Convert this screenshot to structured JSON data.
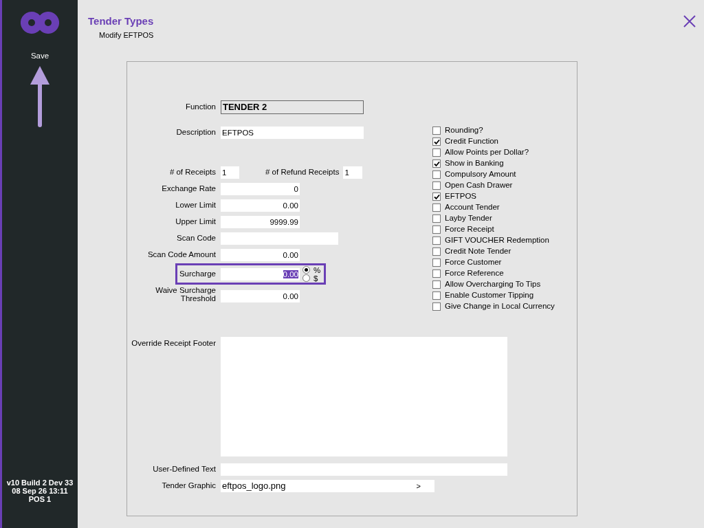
{
  "sidebar": {
    "save": "Save",
    "version_lines": [
      "v10 Build 2 Dev 33",
      "08 Sep 26 13:11",
      "POS 1"
    ]
  },
  "header": {
    "title": "Tender Types",
    "subtitle": "Modify EFTPOS"
  },
  "form": {
    "function": {
      "label": "Function",
      "value": "TENDER 2"
    },
    "description": {
      "label": "Description",
      "value": "EFTPOS"
    },
    "receipts": {
      "label": "# of Receipts",
      "value": "1"
    },
    "refund_receipts": {
      "label": "# of Refund Receipts",
      "value": "1"
    },
    "exchange_rate": {
      "label": "Exchange Rate",
      "value": "0"
    },
    "lower_limit": {
      "label": "Lower Limit",
      "value": "0.00"
    },
    "upper_limit": {
      "label": "Upper Limit",
      "value": "9999.99"
    },
    "scan_code": {
      "label": "Scan Code"
    },
    "scan_code_amount": {
      "label": "Scan Code Amount",
      "value": "0.00"
    },
    "surcharge": {
      "label": "Surcharge",
      "value": "0.00",
      "text_selected": true,
      "highlighted": true,
      "units": [
        {
          "label": "%",
          "selected": true
        },
        {
          "label": "$",
          "selected": false
        }
      ]
    },
    "waive_threshold": {
      "label": "Waive Surcharge Threshold",
      "value": "0.00"
    },
    "receipt_footer": {
      "label": "Override Receipt Footer"
    },
    "user_text": {
      "label": "User-Defined Text"
    },
    "tender_graphic": {
      "label": "Tender Graphic",
      "value": "eftpos_logo.png",
      "button": ">"
    }
  },
  "options": [
    {
      "label": "Rounding?",
      "checked": false
    },
    {
      "label": "Credit Function",
      "checked": true
    },
    {
      "label": "Allow Points per Dollar?",
      "checked": false
    },
    {
      "label": "Show in Banking",
      "checked": true
    },
    {
      "label": "Compulsory Amount",
      "checked": false
    },
    {
      "label": "Open Cash Drawer",
      "checked": false
    },
    {
      "label": "EFTPOS",
      "checked": true
    },
    {
      "label": "Account Tender",
      "checked": false
    },
    {
      "label": "Layby Tender",
      "checked": false
    },
    {
      "label": "Force Receipt",
      "checked": false
    },
    {
      "label": "GIFT VOUCHER Redemption",
      "checked": false
    },
    {
      "label": "Credit Note Tender",
      "checked": false
    },
    {
      "label": "Force Customer",
      "checked": false
    },
    {
      "label": "Force Reference",
      "checked": false
    },
    {
      "label": "Allow Overcharging To Tips",
      "checked": false
    },
    {
      "label": "Enable Customer Tipping",
      "checked": false
    },
    {
      "label": "Give Change in Local Currency",
      "checked": false
    }
  ]
}
